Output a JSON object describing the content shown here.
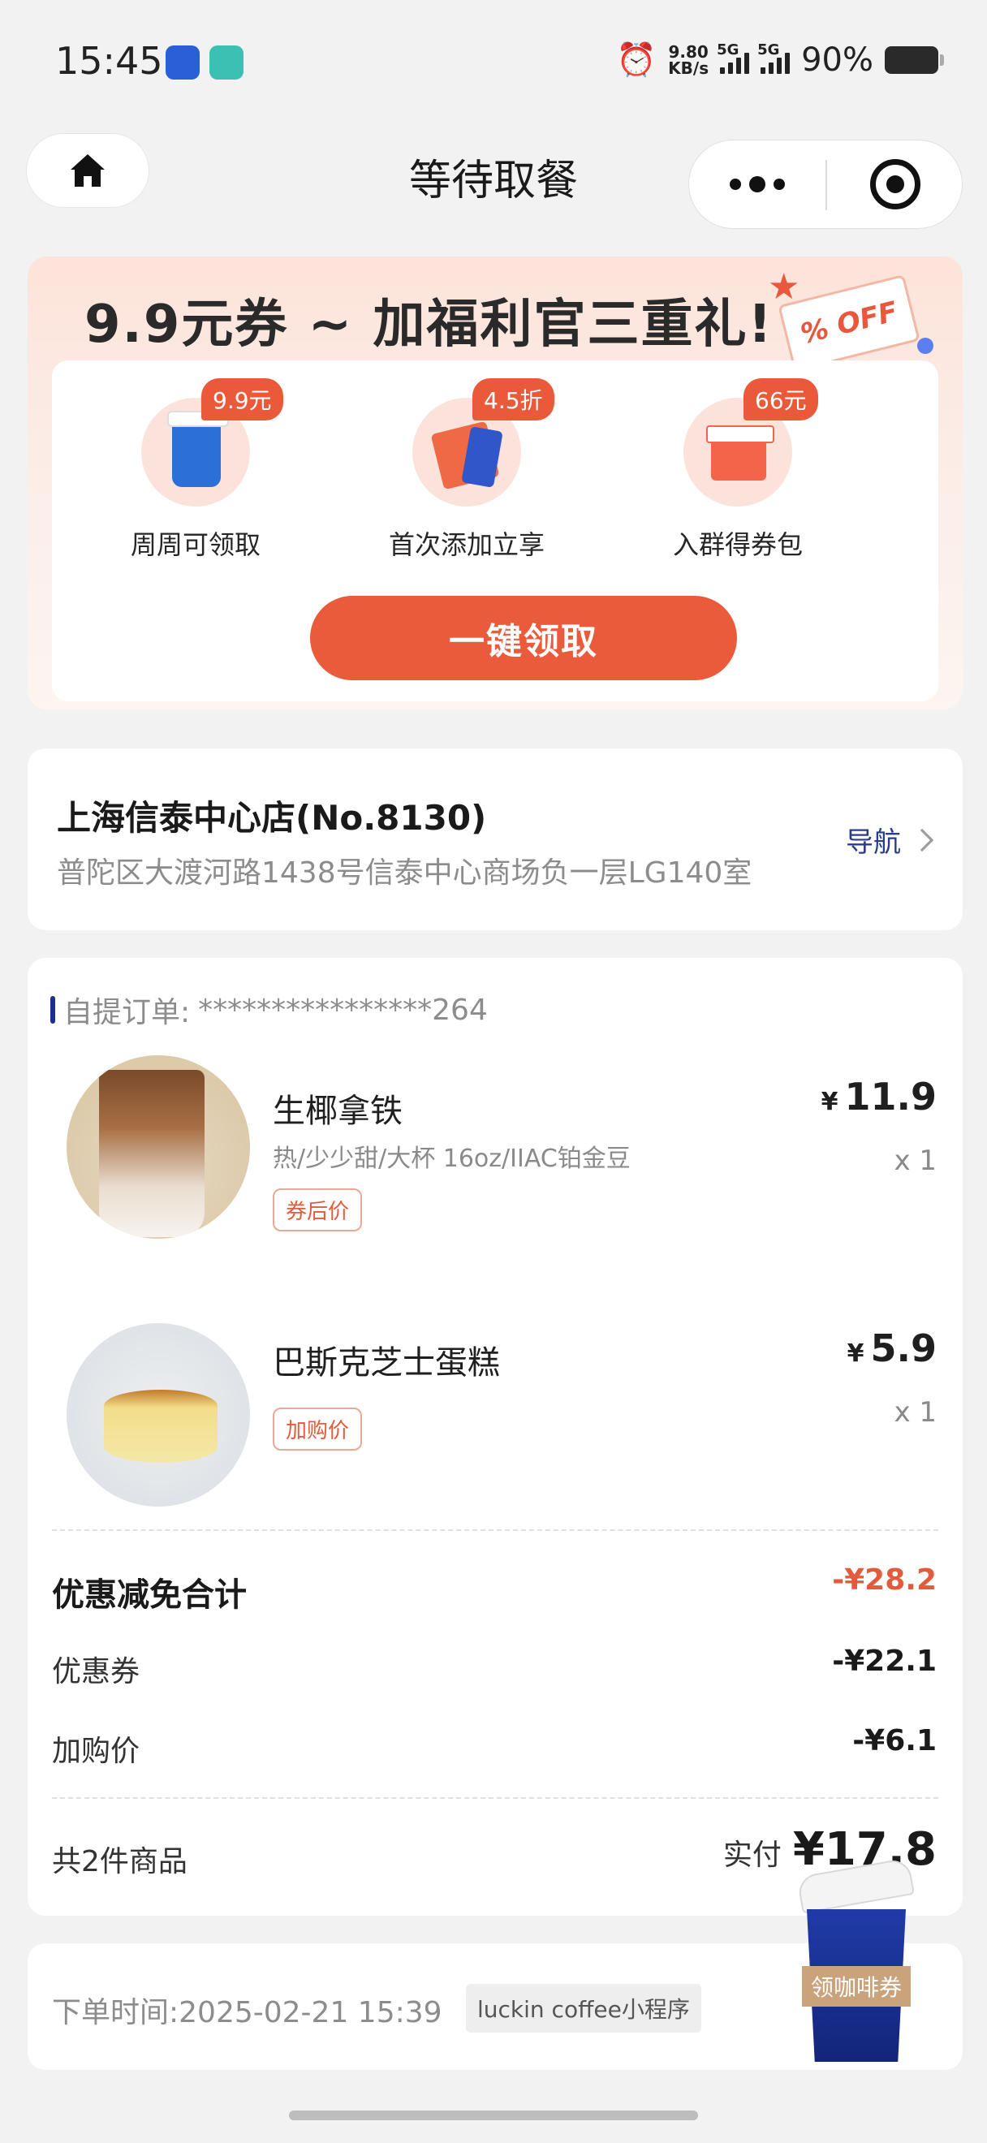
{
  "status_bar": {
    "time": "15:45",
    "net_speed_value": "9.80",
    "net_speed_unit": "KB/s",
    "signal1_label": "5G",
    "signal2_label": "5G",
    "battery": "90%"
  },
  "nav": {
    "title": "等待取餐"
  },
  "promo": {
    "title": "9.9元券 ~ 加福利官三重礼!",
    "off_tag": "% OFF",
    "benefits": [
      {
        "badge": "9.9元",
        "label": "周周可领取",
        "icon": "coffee-cup"
      },
      {
        "badge": "4.5折",
        "label": "首次添加立享",
        "icon": "coupon-ticket"
      },
      {
        "badge": "66元",
        "label": "入群得券包",
        "icon": "gift-box"
      }
    ],
    "cta": "一键领取"
  },
  "store": {
    "name": "上海信泰中心店(No.8130)",
    "address": "普陀区大渡河路1438号信泰中心商场负一层LG140室",
    "nav_label": "导航"
  },
  "order": {
    "head_label": "自提订单:",
    "order_no": "****************264",
    "items": [
      {
        "name": "生椰拿铁",
        "spec": "热/少少甜/大杯 16oz/IIAC铂金豆",
        "tag": "券后价",
        "currency": "¥",
        "price": "11.9",
        "qty": "x 1"
      },
      {
        "name": "巴斯克芝士蛋糕",
        "spec": "",
        "tag": "加购价",
        "currency": "¥",
        "price": "5.9",
        "qty": "x 1"
      }
    ],
    "discount_total_label": "优惠减免合计",
    "discount_total_value": "-¥28.2",
    "coupon_label": "优惠券",
    "coupon_value": "-¥22.1",
    "addon_label": "加购价",
    "addon_value": "-¥6.1",
    "count_label": "共2件商品",
    "paid_label": "实付",
    "paid_value": "¥17.8"
  },
  "order_time": {
    "text": "下单时间:2025-02-21 15:39",
    "source": "luckin coffee小程序"
  },
  "float_coupon": {
    "label": "领咖啡券"
  },
  "colors": {
    "accent": "#ea5b3c",
    "brand_blue": "#1d2f8c"
  }
}
